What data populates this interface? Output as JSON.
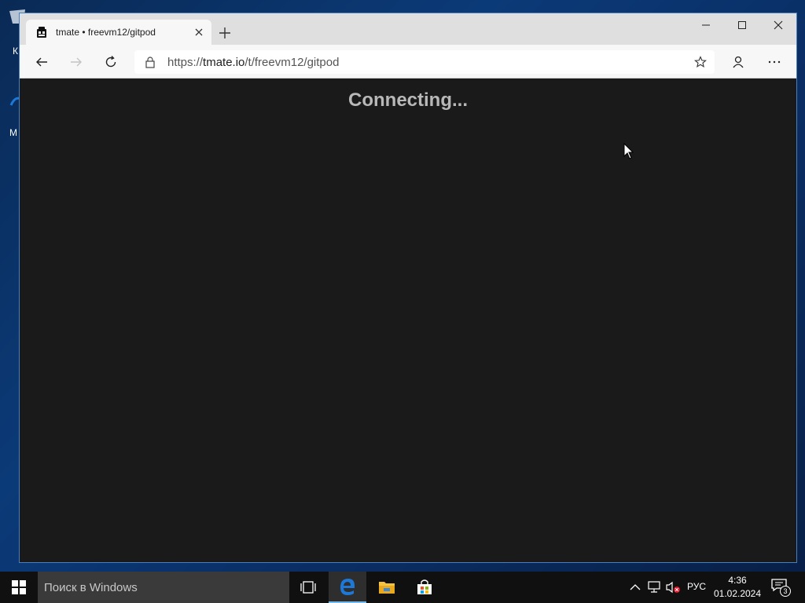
{
  "desktop": {
    "icons": [
      {
        "label": "К"
      },
      {
        "label": "M"
      }
    ]
  },
  "browser": {
    "tab": {
      "title": "tmate • freevm12/gitpod"
    },
    "address_bar": {
      "scheme": "https://",
      "host": "tmate.io",
      "path": "/t/freevm12/gitpod"
    },
    "content": {
      "status_text": "Connecting..."
    }
  },
  "taskbar": {
    "search_placeholder": "Поиск в Windows",
    "language": "РУС",
    "time": "4:36",
    "date": "01.02.2024",
    "notification_count": "3"
  },
  "colors": {
    "page_background": "#1a1a1a",
    "status_text": "#b8b8b8",
    "edge_blue": "#1e78d7",
    "taskbar": "#101010"
  }
}
